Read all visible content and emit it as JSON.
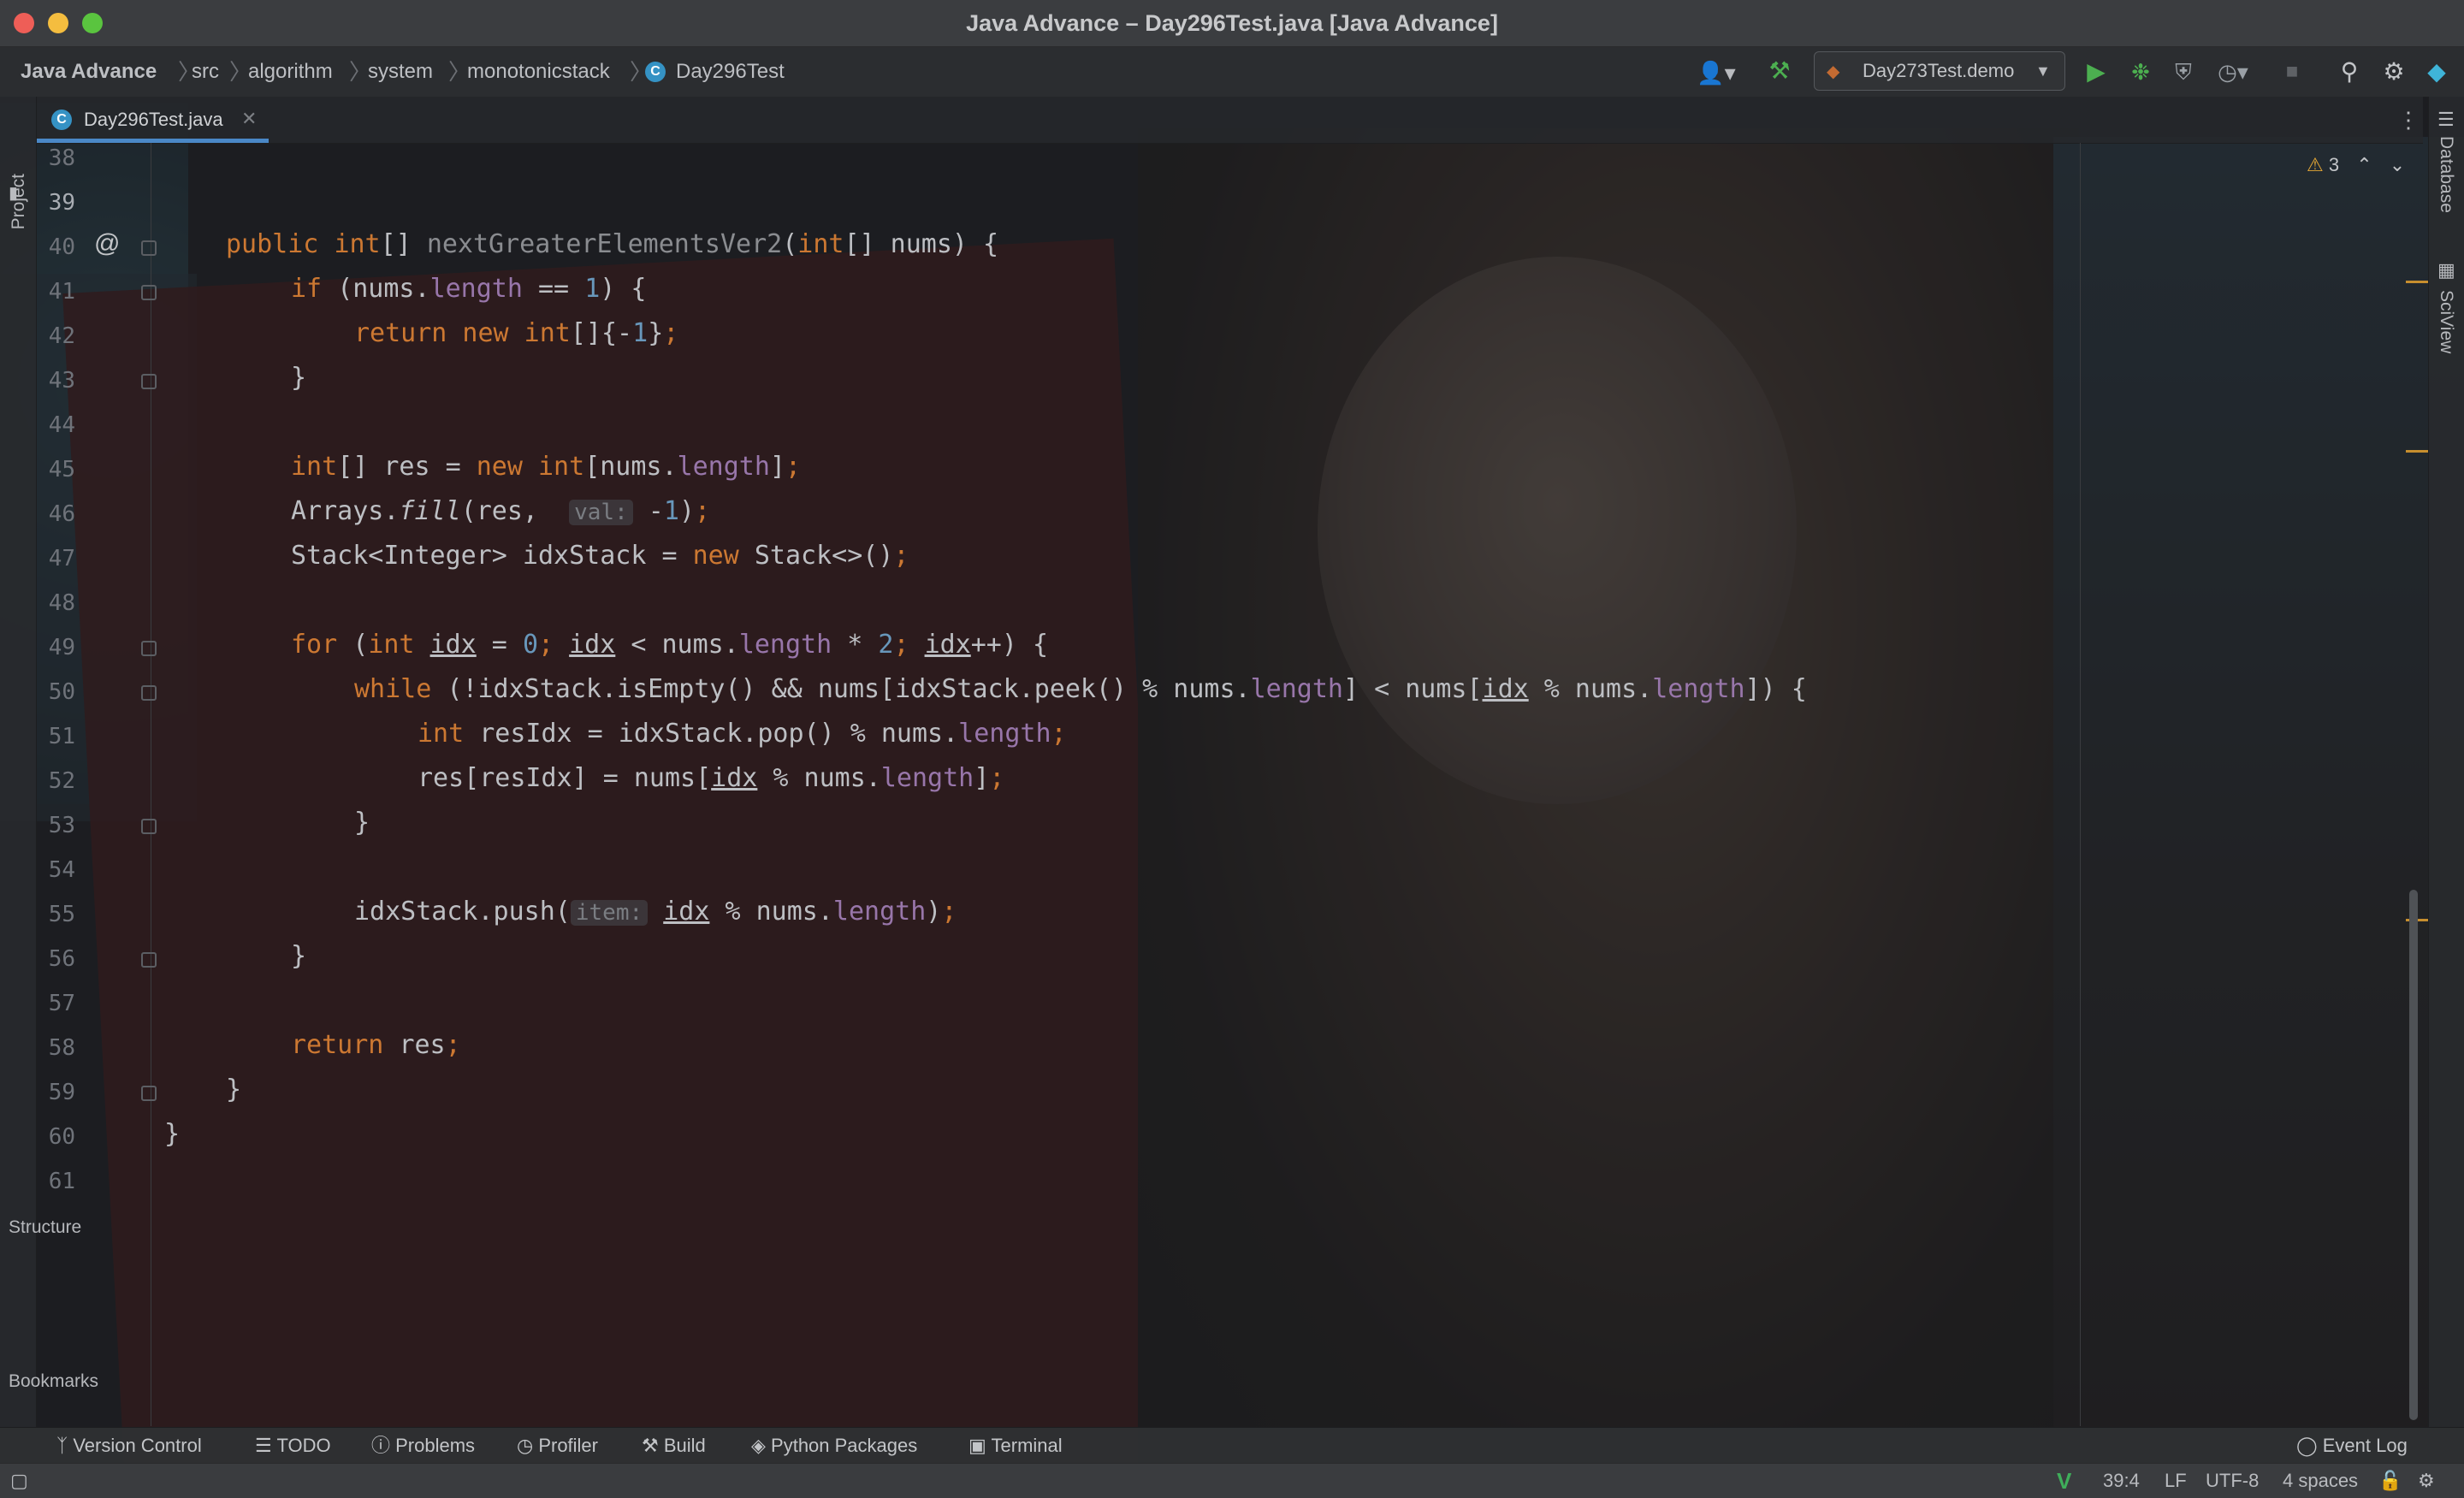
{
  "window": {
    "title": "Java Advance – Day296Test.java [Java Advance]"
  },
  "breadcrumb": {
    "items": [
      "Java Advance",
      "src",
      "algorithm",
      "system",
      "monotonicstack",
      "Day296Test"
    ]
  },
  "toolbar": {
    "run_config": "Day273Test.demo"
  },
  "tab": {
    "label": "Day296Test.java",
    "icon": "C"
  },
  "editor": {
    "warnings": "3",
    "line_numbers": [
      "38",
      "39",
      "40",
      "41",
      "42",
      "43",
      "44",
      "45",
      "46",
      "47",
      "48",
      "49",
      "50",
      "51",
      "52",
      "53",
      "54",
      "55",
      "56",
      "57",
      "58",
      "59",
      "60",
      "61"
    ],
    "gutter_marker": "@",
    "inlay_hints": {
      "val": "val:",
      "item": "item:"
    },
    "lines": {
      "l40": {
        "a": "public ",
        "b": "int",
        "c": "[] ",
        "d": "nextGreaterElementsVer2",
        "e": "(",
        "f": "int",
        "g": "[] nums) {"
      },
      "l41": {
        "a": "if ",
        "b": "(nums.",
        "c": "length",
        "d": " == ",
        "e": "1",
        "f": ") {"
      },
      "l42": {
        "a": "return new int",
        "b": "[]{-",
        "c": "1",
        "d": "}",
        "e": ";"
      },
      "l43": {
        "a": "}"
      },
      "l45": {
        "a": "int",
        "b": "[] res = ",
        "c": "new int",
        "d": "[nums.",
        "e": "length",
        "f": "]",
        "g": ";"
      },
      "l46": {
        "a": "Arrays.",
        "b": "fill",
        "c": "(res,  ",
        "d": " -",
        "e": "1",
        "f": ")",
        "g": ";"
      },
      "l47": {
        "a": "Stack<Integer> idxStack = ",
        "b": "new ",
        "c": "Stack<>()",
        "d": ";"
      },
      "l49": {
        "a": "for ",
        "b": "(",
        "c": "int ",
        "d": "idx",
        "e": " = ",
        "f": "0",
        "g": "; ",
        "h": "idx",
        "i": " < nums.",
        "j": "length",
        "k": " * ",
        "l": "2",
        "m": "; ",
        "n": "idx",
        "o": "++) {"
      },
      "l50": {
        "a": "while ",
        "b": "(!idxStack.isEmpty() && nums[idxStack.peek() % nums.",
        "c": "length",
        "d": "] < nums[",
        "e": "idx",
        "f": " % nums.",
        "g": "length",
        "h": "]) {"
      },
      "l51": {
        "a": "int ",
        "b": "resIdx = idxStack.pop() % nums.",
        "c": "length",
        "d": ";"
      },
      "l52": {
        "a": "res[resIdx] = nums[",
        "b": "idx",
        "c": " % nums.",
        "d": "length",
        "e": "]",
        "f": ";"
      },
      "l53": {
        "a": "}"
      },
      "l55": {
        "a": "idxStack.push(",
        "b": " ",
        "c": "idx",
        "d": " % nums.",
        "e": "length",
        "f": ")",
        "g": ";"
      },
      "l56": {
        "a": "}"
      },
      "l58": {
        "a": "return ",
        "b": "res",
        "c": ";"
      },
      "l59": {
        "a": "}"
      },
      "l60": {
        "a": "}"
      }
    }
  },
  "side_panels": {
    "left": [
      "Project",
      "Structure",
      "Bookmarks"
    ],
    "right": [
      "Database",
      "SciView"
    ]
  },
  "tool_windows": [
    "Version Control",
    "TODO",
    "Problems",
    "Profiler",
    "Build",
    "Python Packages",
    "Terminal"
  ],
  "event_log": "Event Log",
  "status": {
    "position": "39:4",
    "line_sep": "LF",
    "encoding": "UTF-8",
    "indent": "4 spaces"
  },
  "colors": {
    "keyword": "#cc7832",
    "number": "#6897bb",
    "field": "#9876aa",
    "accent": "#4a88c7",
    "warning": "#e3a635"
  }
}
